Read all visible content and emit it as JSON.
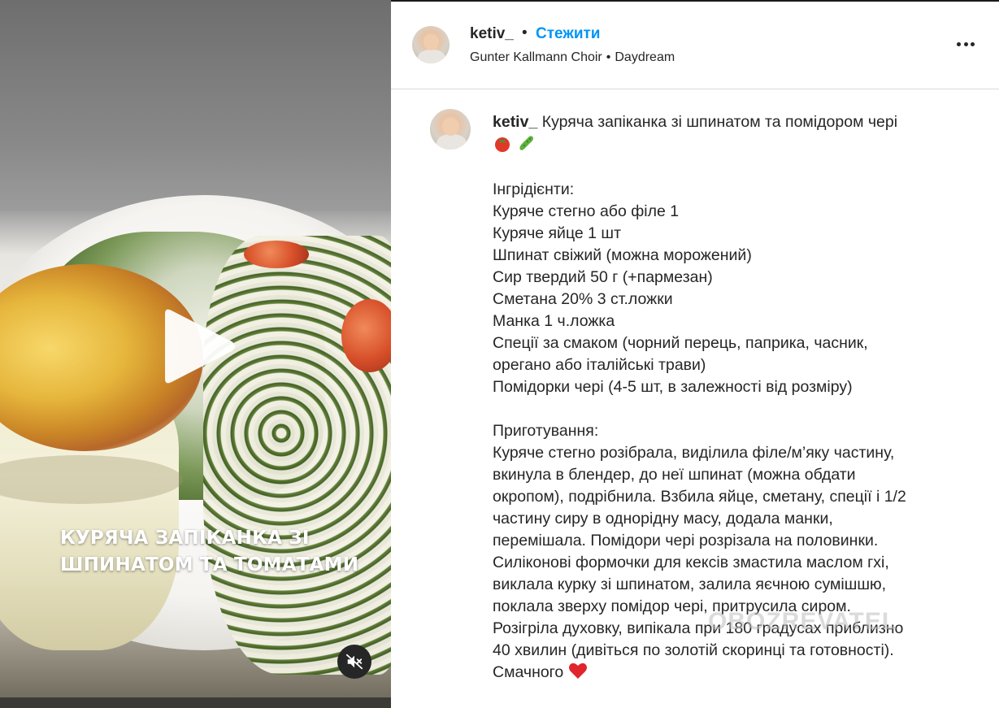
{
  "video": {
    "overlay_title": "КУРЯЧА ЗАПІКАНКА ЗІ ШПИНАТОМ ТА ТОМАТАМИ",
    "play_icon": "play-icon",
    "mute_icon": "speaker-muted-icon"
  },
  "header": {
    "username": "ketiv_",
    "dot": "•",
    "follow_label": "Стежити",
    "audio_artist": "Gunter Kallmann Choir",
    "audio_sep": "•",
    "audio_track": "Daydream",
    "more_icon": "more-horizontal-icon"
  },
  "caption": {
    "username": "ketiv_",
    "title": "Куряча запіканка зі шпинатом та помідором чері",
    "title_emojis": [
      "tomato-emoji",
      "cucumber-emoji"
    ],
    "ingredients_heading": "Інгрідієнти:",
    "ingredients": [
      "Куряче стегно або філе 1",
      "Куряче яйце 1 шт",
      "Шпинат свіжий (можна морожений)",
      "Сир твердий 50 г (+пармезан)",
      "Сметана 20% 3 ст.ложки",
      "Манка 1 ч.ложка",
      "Спеції за смаком (чорний перець, паприка, часник,",
      "орегано або італійські трави)",
      "Помідорки чері (4-5 шт, в залежності від розміру)"
    ],
    "method_heading": "Приготування:",
    "method": [
      "Куряче стегно розібрала, виділила філе/м’яку частину,",
      "вкинула в блендер, до неї шпинат (можна обдати",
      "окропом), подрібнила. Взбила яйце, сметану, спеції і 1/2",
      "частину сиру в однорідну масу, додала манки,",
      "перемішала. Помідори чері розрізала на половинки.",
      "Силіконові формочки для кексів змастила маслом гхі,",
      "виклала курку зі шпинатом, залила яєчною сумішшю,",
      "поклала зверху помідор чері, притрусила сиром.",
      "Розігріла духовку, випікала при 180 градусах приблизно",
      "40 хвилин (дивіться по золотій скоринці та готовності)."
    ],
    "closing": "Смачного",
    "closing_emoji": "red-heart-emoji"
  },
  "watermark": "OBOZREVATEL",
  "colors": {
    "follow": "#0095f6",
    "text": "#262626",
    "divider": "#dbdbdb",
    "mute_bg": "#262626"
  }
}
